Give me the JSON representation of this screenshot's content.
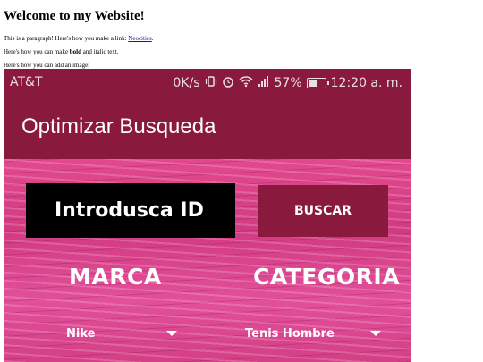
{
  "page": {
    "heading": "Welcome to my Website!",
    "para1_text": "This is a paragraph! Here's how you make a link: ",
    "para1_link": "Neocities",
    "para1_end": ".",
    "para2_before": "Here's how you can make ",
    "para2_bold": "bold",
    "para2_after": " and italic text.",
    "para3": "Here's how you can add an image:"
  },
  "phone": {
    "status_bar": {
      "carrier": "AT&T",
      "speed": "0K/s",
      "battery_text": "57%",
      "battery_level": 0.57,
      "time": "12:20 a. m.",
      "icons": [
        "vibrate-icon",
        "alarm-icon",
        "wifi-icon",
        "signal-icon",
        "battery-icon"
      ]
    },
    "app_bar": {
      "title": "Optimizar Busqueda"
    },
    "form": {
      "id_placeholder": "Introdusca ID",
      "search_label": "BUSCAR",
      "brand_label": "MARCA",
      "category_label": "CATEGORIA",
      "brand_value": "Nike",
      "category_value": "Tenis Hombre"
    },
    "colors": {
      "bar": "#8a1a3d",
      "background_pink": "#d23a82",
      "input_bg": "#000000"
    }
  }
}
